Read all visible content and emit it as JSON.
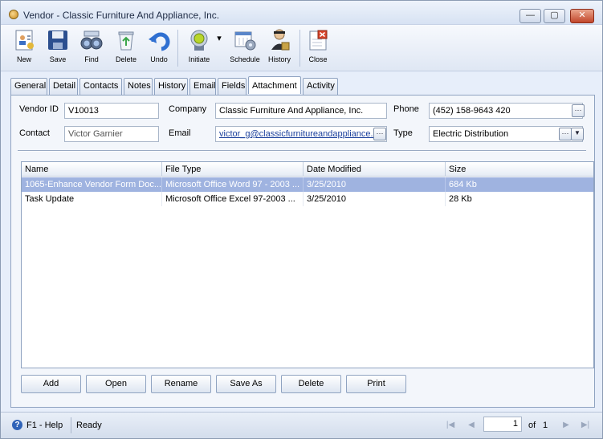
{
  "window": {
    "title": "Vendor - Classic Furniture And Appliance, Inc.",
    "minimize": "—",
    "maximize": "▢",
    "close": "✕"
  },
  "toolbar": {
    "new": "New",
    "save": "Save",
    "find": "Find",
    "delete": "Delete",
    "undo": "Undo",
    "initiate": "Initiate",
    "schedule": "Schedule",
    "history": "History",
    "close": "Close",
    "dropdown_glyph": "▾"
  },
  "tabs": [
    "General",
    "Detail",
    "Contacts",
    "Notes",
    "History",
    "Email",
    "Fields",
    "Attachment",
    "Activity"
  ],
  "active_tab": "Attachment",
  "form": {
    "vendor_id_label": "Vendor ID",
    "vendor_id": "V10013",
    "company_label": "Company",
    "company": "Classic Furniture And Appliance, Inc.",
    "phone_label": "Phone",
    "phone": "(452) 158-9643 420",
    "contact_label": "Contact",
    "contact": "Victor Garnier",
    "email_label": "Email",
    "email": "victor_g@classicfurnitureandappliance.c",
    "type_label": "Type",
    "type": "Electric Distribution",
    "ellipsis": "···",
    "dropdown": "▼"
  },
  "grid": {
    "columns": [
      "Name",
      "File Type",
      "Date Modified",
      "Size"
    ],
    "rows": [
      [
        "1065-Enhance Vendor Form Doc...",
        "Microsoft Office Word 97 - 2003 ...",
        "3/25/2010",
        "684 Kb"
      ],
      [
        "Task Update",
        "Microsoft Office Excel 97-2003 ...",
        "3/25/2010",
        "28 Kb"
      ]
    ]
  },
  "actions": {
    "add": "Add",
    "open": "Open",
    "rename": "Rename",
    "save_as": "Save As",
    "delete": "Delete",
    "print": "Print"
  },
  "status": {
    "help": "F1 - Help",
    "state": "Ready",
    "page": "1",
    "of_label": "of",
    "total_pages": "1",
    "first": "|◀",
    "prev": "◀",
    "next": "▶",
    "last": "▶|"
  },
  "colors": {
    "selected_row": "#9fb3e0",
    "window_bg": "#e7eefa"
  }
}
